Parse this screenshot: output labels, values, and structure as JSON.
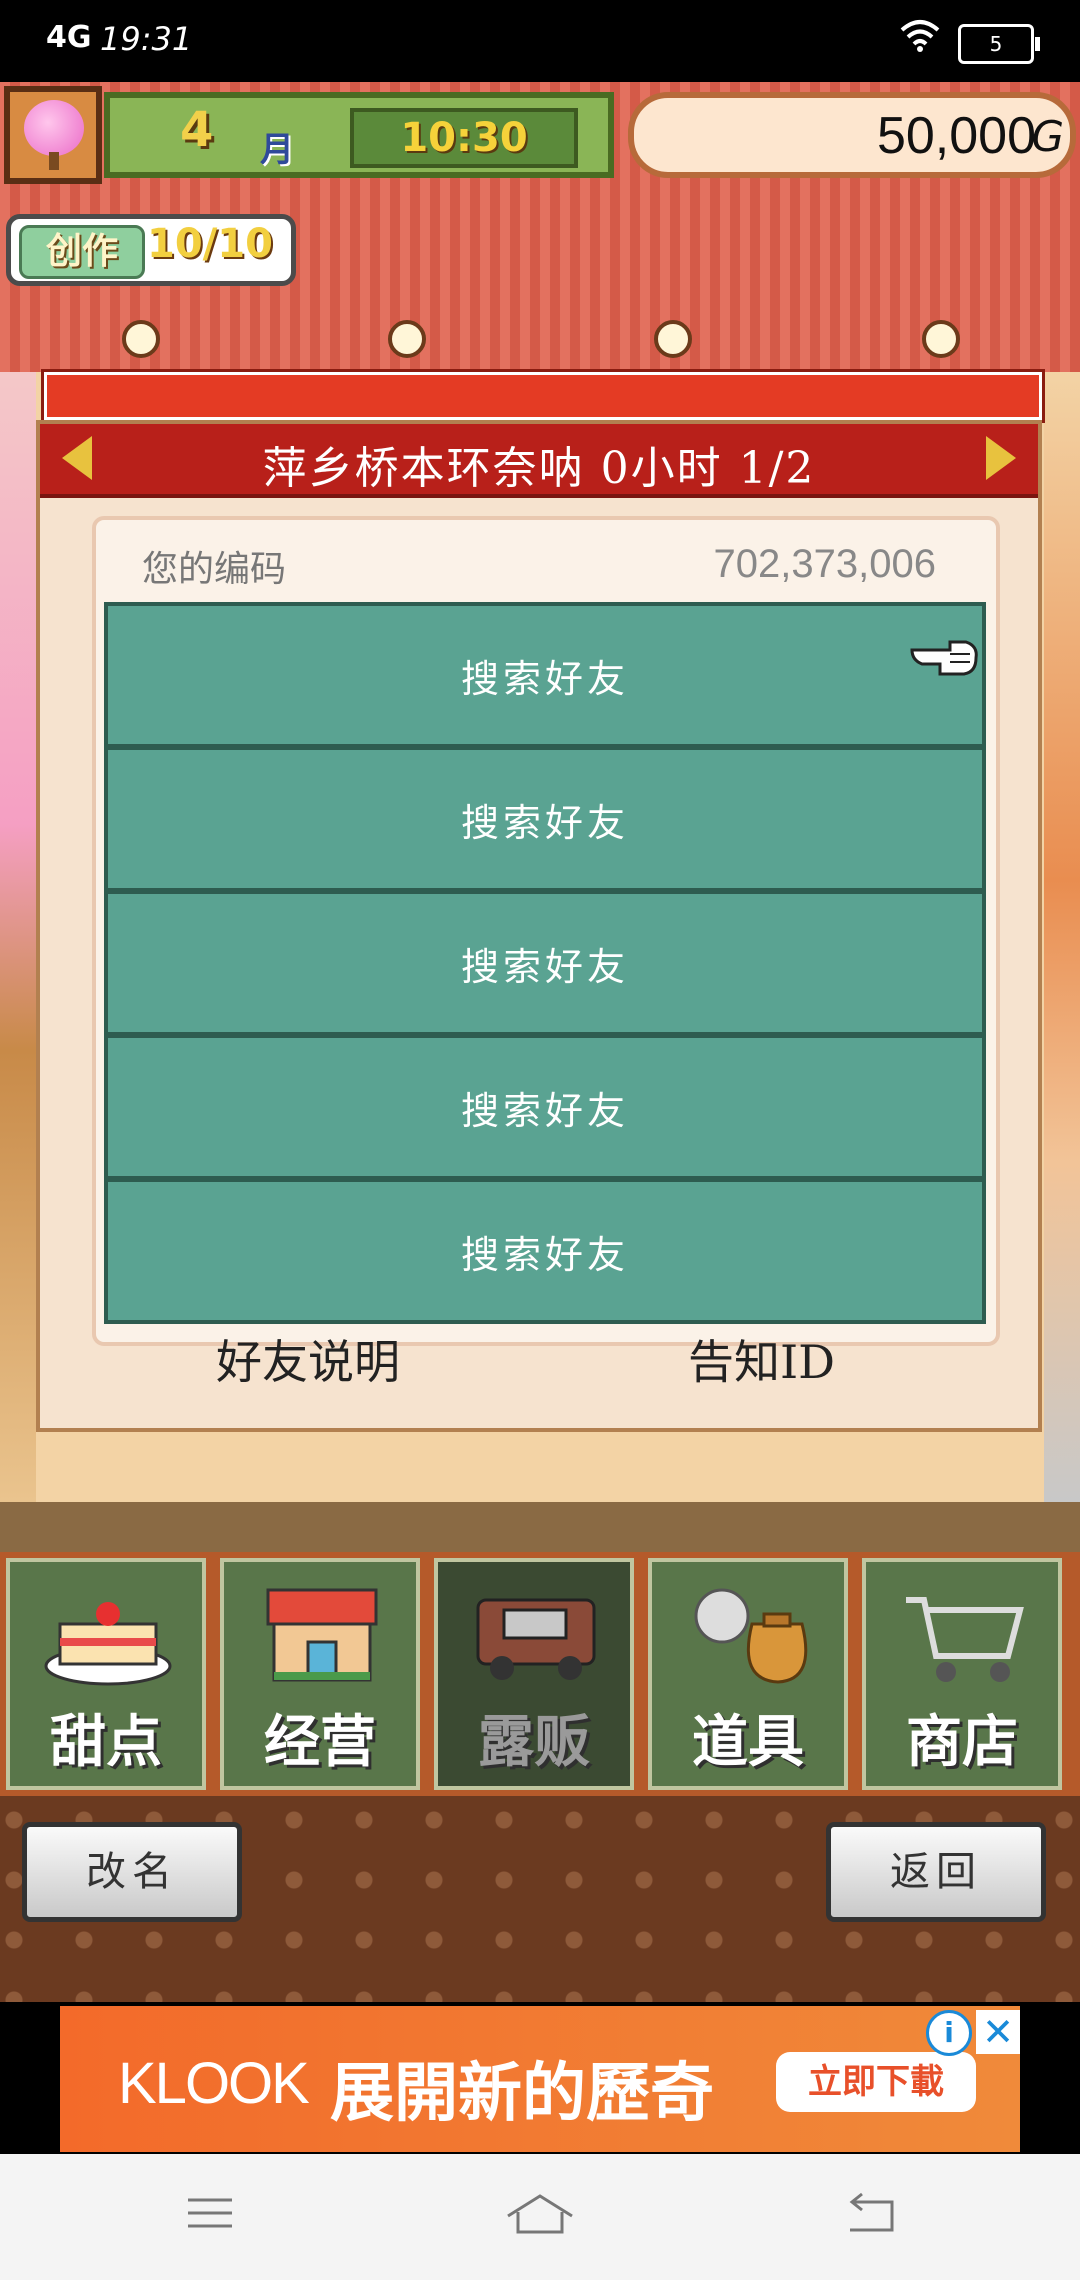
{
  "status_bar": {
    "signal": "4G",
    "time": "19:31",
    "battery": "5"
  },
  "hud": {
    "month_number": "4",
    "month_label": "月",
    "clock": "10:30",
    "money": "50,000",
    "money_unit": "G",
    "craft_label": "创作",
    "craft_value": "10/10"
  },
  "dialog": {
    "title": "萍乡桥本环奈呐 0小时 1/2",
    "code_label": "您的编码",
    "code_value": "702,373,006",
    "friend_slots": [
      "搜索好友",
      "搜索好友",
      "搜索好友",
      "搜索好友",
      "搜索好友"
    ],
    "left_action": "好友说明",
    "right_action": "告知ID"
  },
  "tabs": [
    {
      "label": "甜点",
      "icon": "cake-icon",
      "active": false
    },
    {
      "label": "经营",
      "icon": "shop-building-icon",
      "active": false
    },
    {
      "label": "露贩",
      "icon": "food-truck-icon",
      "active": true
    },
    {
      "label": "道具",
      "icon": "item-bag-icon",
      "active": false
    },
    {
      "label": "商店",
      "icon": "shopping-cart-icon",
      "active": false
    }
  ],
  "bottom_buttons": {
    "rename": "改名",
    "back": "返回"
  },
  "ad": {
    "brand": "KLOOK",
    "text": "展開新的歷奇",
    "cta": "立即下載"
  },
  "colors": {
    "teal_button": "#5aa392",
    "header_red": "#b8201a",
    "tab_green": "#59764a",
    "ad_orange": "#f36a2a"
  }
}
